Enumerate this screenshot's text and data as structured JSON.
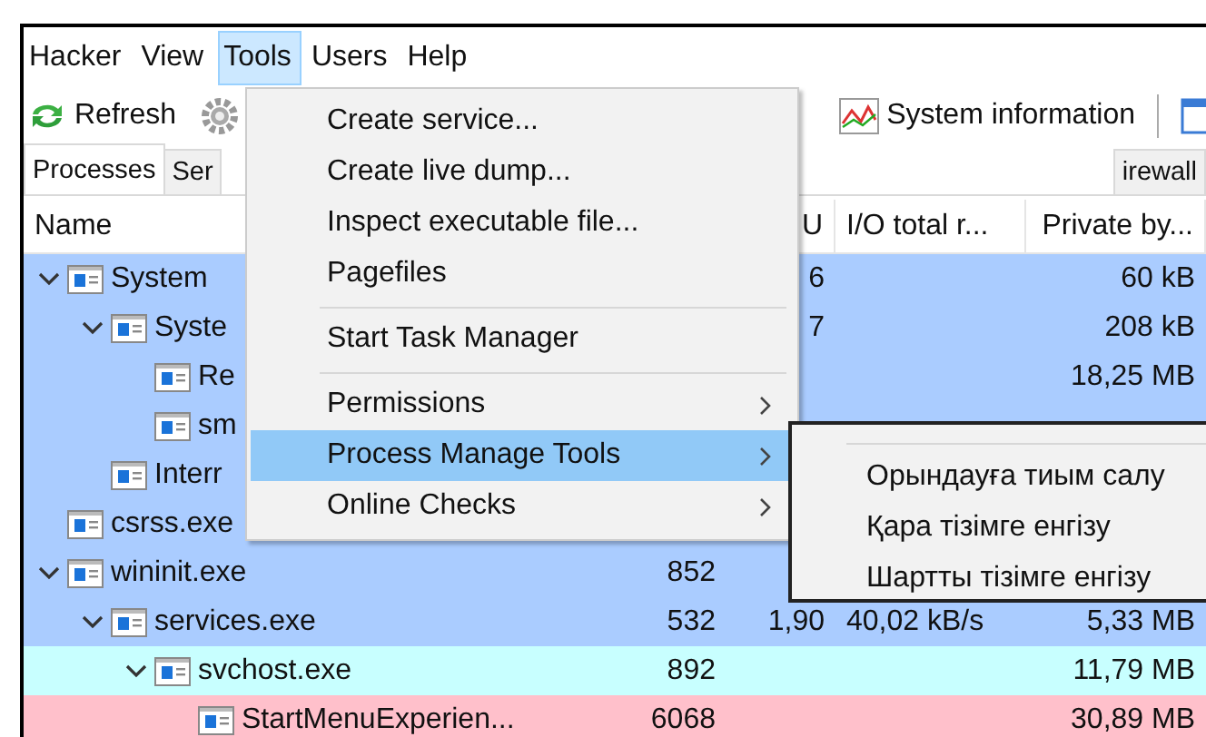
{
  "menu_bar": [
    {
      "label": "Hacker",
      "selected": false
    },
    {
      "label": "View",
      "selected": false
    },
    {
      "label": "Tools",
      "selected": true
    },
    {
      "label": "Users",
      "selected": false
    },
    {
      "label": "Help",
      "selected": false
    }
  ],
  "toolbar": [
    {
      "kind": "refresh",
      "label": "Refresh"
    },
    {
      "kind": "options"
    },
    {
      "kind": "sysinfo",
      "label": "System information"
    },
    {
      "kind": "separator"
    },
    {
      "kind": "window"
    }
  ],
  "tabs": [
    {
      "label": "Processes",
      "selected": true
    },
    {
      "label": "Ser",
      "selected": false
    },
    {
      "label": "irewall",
      "selected": false
    }
  ],
  "columns": {
    "name": "Name",
    "cpu": "U",
    "io": "I/O total r...",
    "private": "Private by..."
  },
  "processes": [
    {
      "name": "System",
      "expanded": true,
      "color": "#aaccff",
      "cpu": "6",
      "private": "60 kB",
      "children": [
        {
          "name": "Syste",
          "expanded": true,
          "color": "#aaccff",
          "cpu": "7",
          "private": "208 kB",
          "children": [
            {
              "name": "Re",
              "color": "#aaccff",
              "private": "18,25 MB"
            },
            {
              "name": "sm",
              "color": "#aaccff"
            }
          ]
        },
        {
          "name": "Interr",
          "color": "#aaccff"
        }
      ]
    },
    {
      "name": "csrss.exe",
      "color": "#aaccff"
    },
    {
      "name": "wininit.exe",
      "expanded": true,
      "color": "#aaccff",
      "pid": "852",
      "children": [
        {
          "name": "services.exe",
          "expanded": true,
          "color": "#aaccff",
          "pid": "532",
          "cpu": "1,90",
          "io": "40,02 kB/s",
          "private": "5,33 MB",
          "children": [
            {
              "name": "svchost.exe",
              "expanded": true,
              "color": "#c8ffff",
              "pid": "892",
              "private": "11,79 MB",
              "children": [
                {
                  "name": "StartMenuExperien...",
                  "color": "#ffc0cb",
                  "pid": "6068",
                  "private": "30,89 MB"
                }
              ]
            }
          ]
        }
      ]
    }
  ],
  "tools_menu": [
    {
      "kind": "item",
      "label": "Create service..."
    },
    {
      "kind": "item",
      "label": "Create live dump..."
    },
    {
      "kind": "item",
      "label": "Inspect executable file..."
    },
    {
      "kind": "item",
      "label": "Pagefiles"
    },
    {
      "kind": "separator"
    },
    {
      "kind": "item",
      "label": "Start Task Manager"
    },
    {
      "kind": "separator"
    },
    {
      "kind": "submenu",
      "label": "Permissions",
      "selected": false
    },
    {
      "kind": "submenu",
      "label": "Process Manage Tools",
      "selected": true
    },
    {
      "kind": "submenu",
      "label": "Online Checks",
      "selected": false
    }
  ],
  "submenu": [
    "Орындауға тиым салу",
    "Қара тізімге енгізу",
    "Шартты тізімге енгізу"
  ]
}
